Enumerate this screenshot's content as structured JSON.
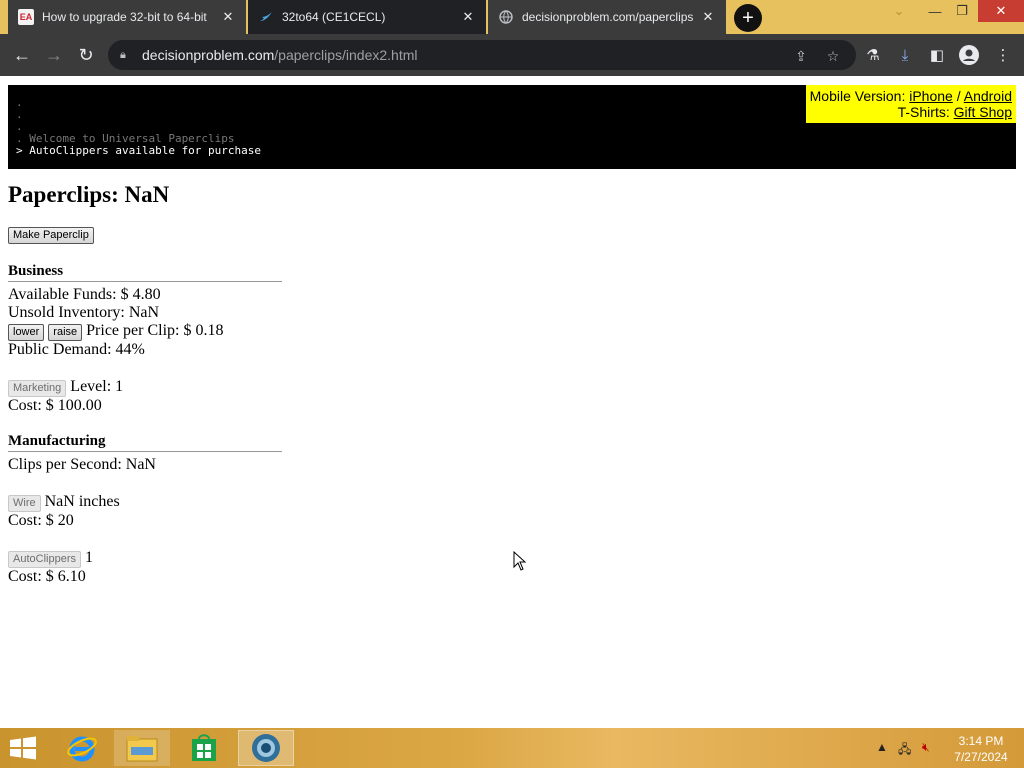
{
  "browser": {
    "tabs": [
      {
        "title": "How to upgrade 32-bit to 64-bit",
        "favicon": "ea-icon"
      },
      {
        "title": "32to64 (CE1CECL)",
        "favicon": "swift-bird-icon"
      },
      {
        "title": "decisionproblem.com/paperclips",
        "favicon": "globe-icon"
      }
    ],
    "url_host": "decisionproblem.com",
    "url_path": "/paperclips/index2.html"
  },
  "console": {
    "lines": [
      ".",
      ".",
      ".",
      ". Welcome to Universal Paperclips",
      "> AutoClippers available for purchase"
    ]
  },
  "promo": {
    "mobile_label": "Mobile Version: ",
    "iphone": "iPhone",
    "sep": " / ",
    "android": "Android",
    "tshirt_label": "T-Shirts: ",
    "gift_shop": "Gift Shop"
  },
  "game": {
    "clips_title": "Paperclips: NaN",
    "make_button": "Make Paperclip",
    "business": {
      "title": "Business",
      "funds": "Available Funds: $ 4.80",
      "inventory": "Unsold Inventory: NaN",
      "lower": "lower",
      "raise": "raise",
      "price": "Price per Clip: $ 0.18",
      "demand": "Public Demand: 44%",
      "marketing_button": "Marketing",
      "marketing_level": "Level: 1",
      "marketing_cost": "Cost: $ 100.00"
    },
    "manufacturing": {
      "title": "Manufacturing",
      "clips_per_second": "Clips per Second: NaN",
      "wire_button": "Wire",
      "wire_amount": "NaN inches",
      "wire_cost": "Cost: $ 20",
      "autoclippers_button": "AutoClippers",
      "autoclippers_count": "1",
      "autoclippers_cost": "Cost: $ 6.10"
    }
  },
  "taskbar": {
    "time": "3:14 PM",
    "date": "7/27/2024"
  }
}
